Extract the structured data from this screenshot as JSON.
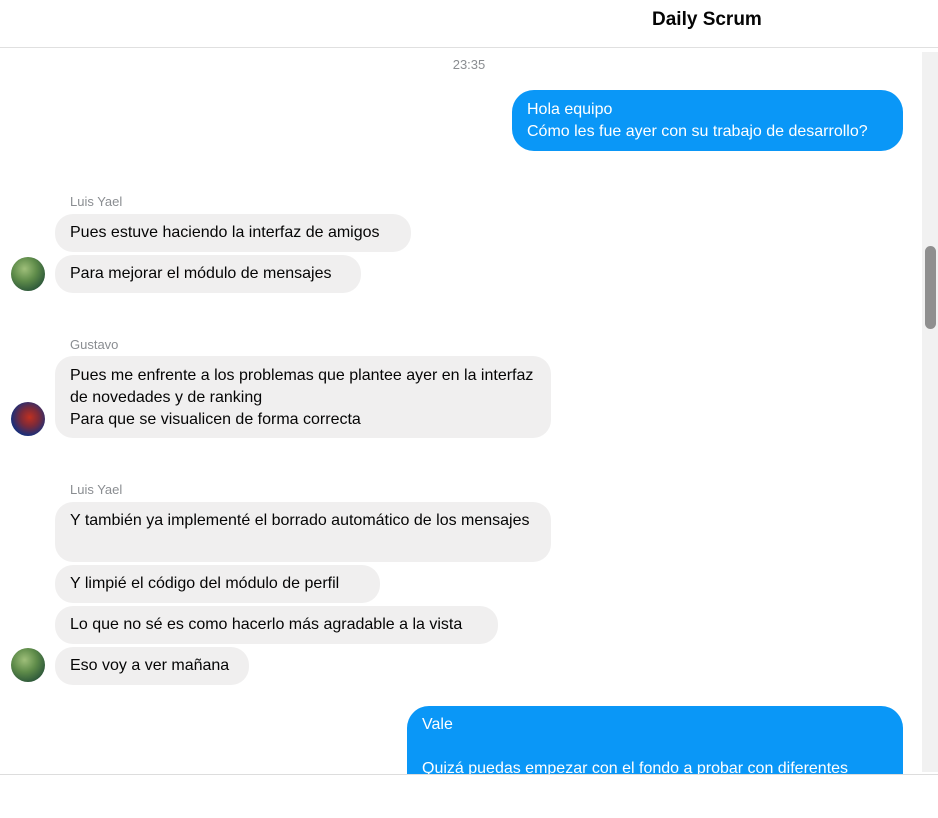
{
  "header": {
    "title": "Daily Scrum"
  },
  "timestamp": "23:35",
  "messages": [
    {
      "from": "me",
      "text": "Hola equipo\nCómo les fue ayer con su trabajo de desarrollo?"
    },
    {
      "sender": "Luis Yael",
      "texts": [
        "Pues estuve haciendo la interfaz de amigos",
        "Para mejorar el módulo de mensajes"
      ]
    },
    {
      "sender": "Gustavo",
      "texts": [
        "Pues me enfrente a los problemas que plantee ayer en la interfaz de novedades y de ranking\nPara que se visualicen de forma correcta"
      ]
    },
    {
      "sender": "Luis Yael",
      "texts": [
        "Y también ya implementé el borrado automático de los mensajes",
        "Y limpié el código del módulo de perfil",
        "Lo que no sé es como hacerlo más agradable a la vista",
        "Eso voy a ver mañana"
      ]
    },
    {
      "from": "me",
      "text": "Vale\n\nQuizá puedas empezar con el fondo a probar con diferentes"
    }
  ],
  "avatars": [
    "avatar-luis-yael",
    "avatar-gustavo"
  ]
}
